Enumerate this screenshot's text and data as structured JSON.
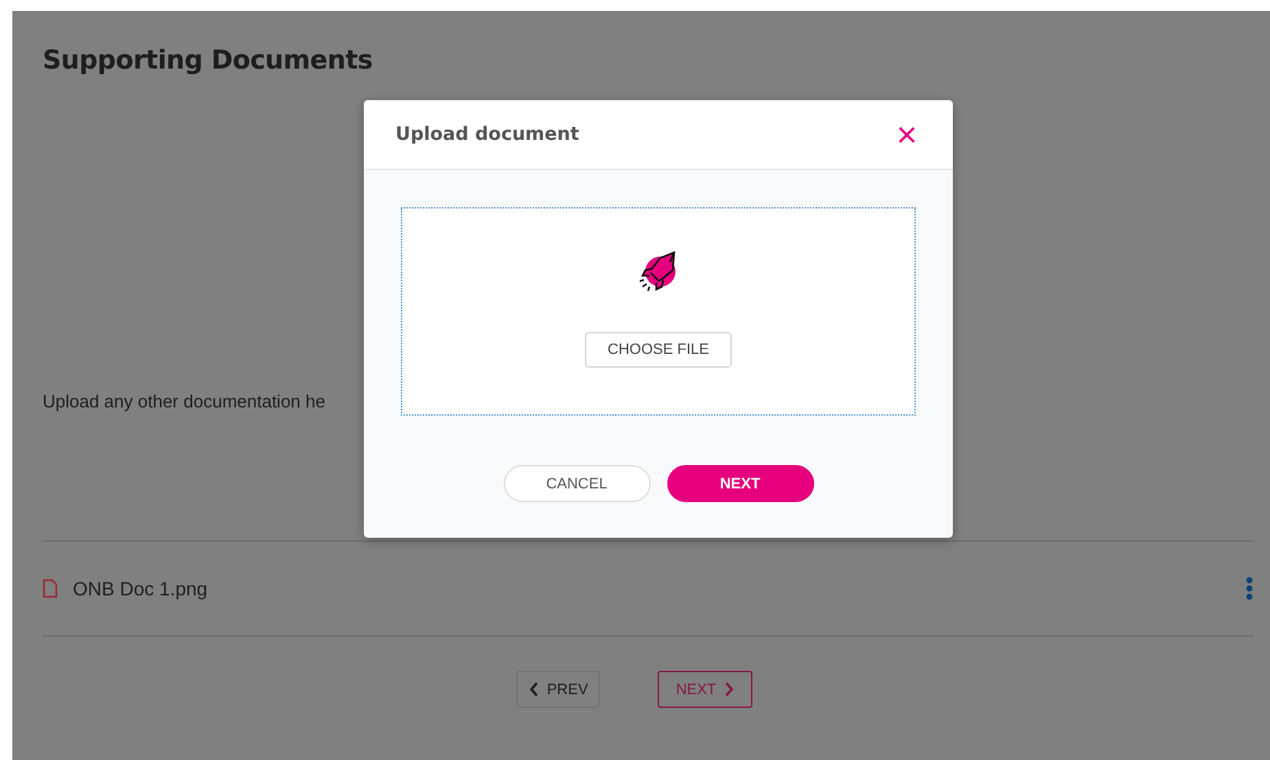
{
  "page": {
    "title": "Supporting Documents",
    "description": "Upload any other documentation he",
    "files": [
      {
        "name": "ONB Doc 1.png"
      }
    ],
    "nav": [
      {
        "label": "PREV",
        "kind": "prev"
      },
      {
        "label": "NEXT",
        "kind": "next"
      }
    ]
  },
  "dialog": {
    "title": "Upload document",
    "close": "×",
    "choose_button": "CHOOSE FILE",
    "buttons": [
      {
        "label": "CANCEL",
        "kind": "secondary"
      },
      {
        "label": "NEXT",
        "kind": "primary"
      }
    ]
  }
}
